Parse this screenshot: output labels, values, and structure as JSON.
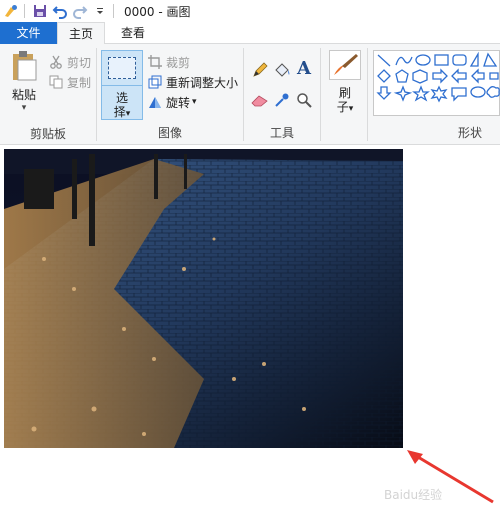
{
  "window": {
    "title": "0000 - 画图",
    "quick_access": {
      "icons": [
        "paint-app-icon",
        "save-icon",
        "undo-icon",
        "redo-icon",
        "customize-qa-icon"
      ]
    }
  },
  "tabs": [
    {
      "label": "文件",
      "active": false
    },
    {
      "label": "主页",
      "active": true
    },
    {
      "label": "查看",
      "active": false
    }
  ],
  "clipboard_group": {
    "label": "剪贴板",
    "paste": "粘贴",
    "cut": "剪切",
    "copy": "复制"
  },
  "image_group": {
    "label": "图像",
    "select_line1": "选",
    "select_line2": "择",
    "crop": "裁剪",
    "resize": "重新调整大小",
    "rotate": "旋转"
  },
  "tools_group": {
    "label": "工具",
    "tools": [
      "pencil-icon",
      "fill-icon",
      "text-icon",
      "eraser-icon",
      "color-picker-icon",
      "magnifier-icon"
    ]
  },
  "brush_group": {
    "line1": "刷",
    "line2": "子"
  },
  "shapes_group": {
    "label": "形状"
  },
  "colors": {
    "file_tab": "#1e6fd0",
    "ribbon_bg": "#f5f6f7",
    "select_highlight": "#cce4f7",
    "annotation_arrow": "#e8372f"
  },
  "watermark": "Baidu经验"
}
